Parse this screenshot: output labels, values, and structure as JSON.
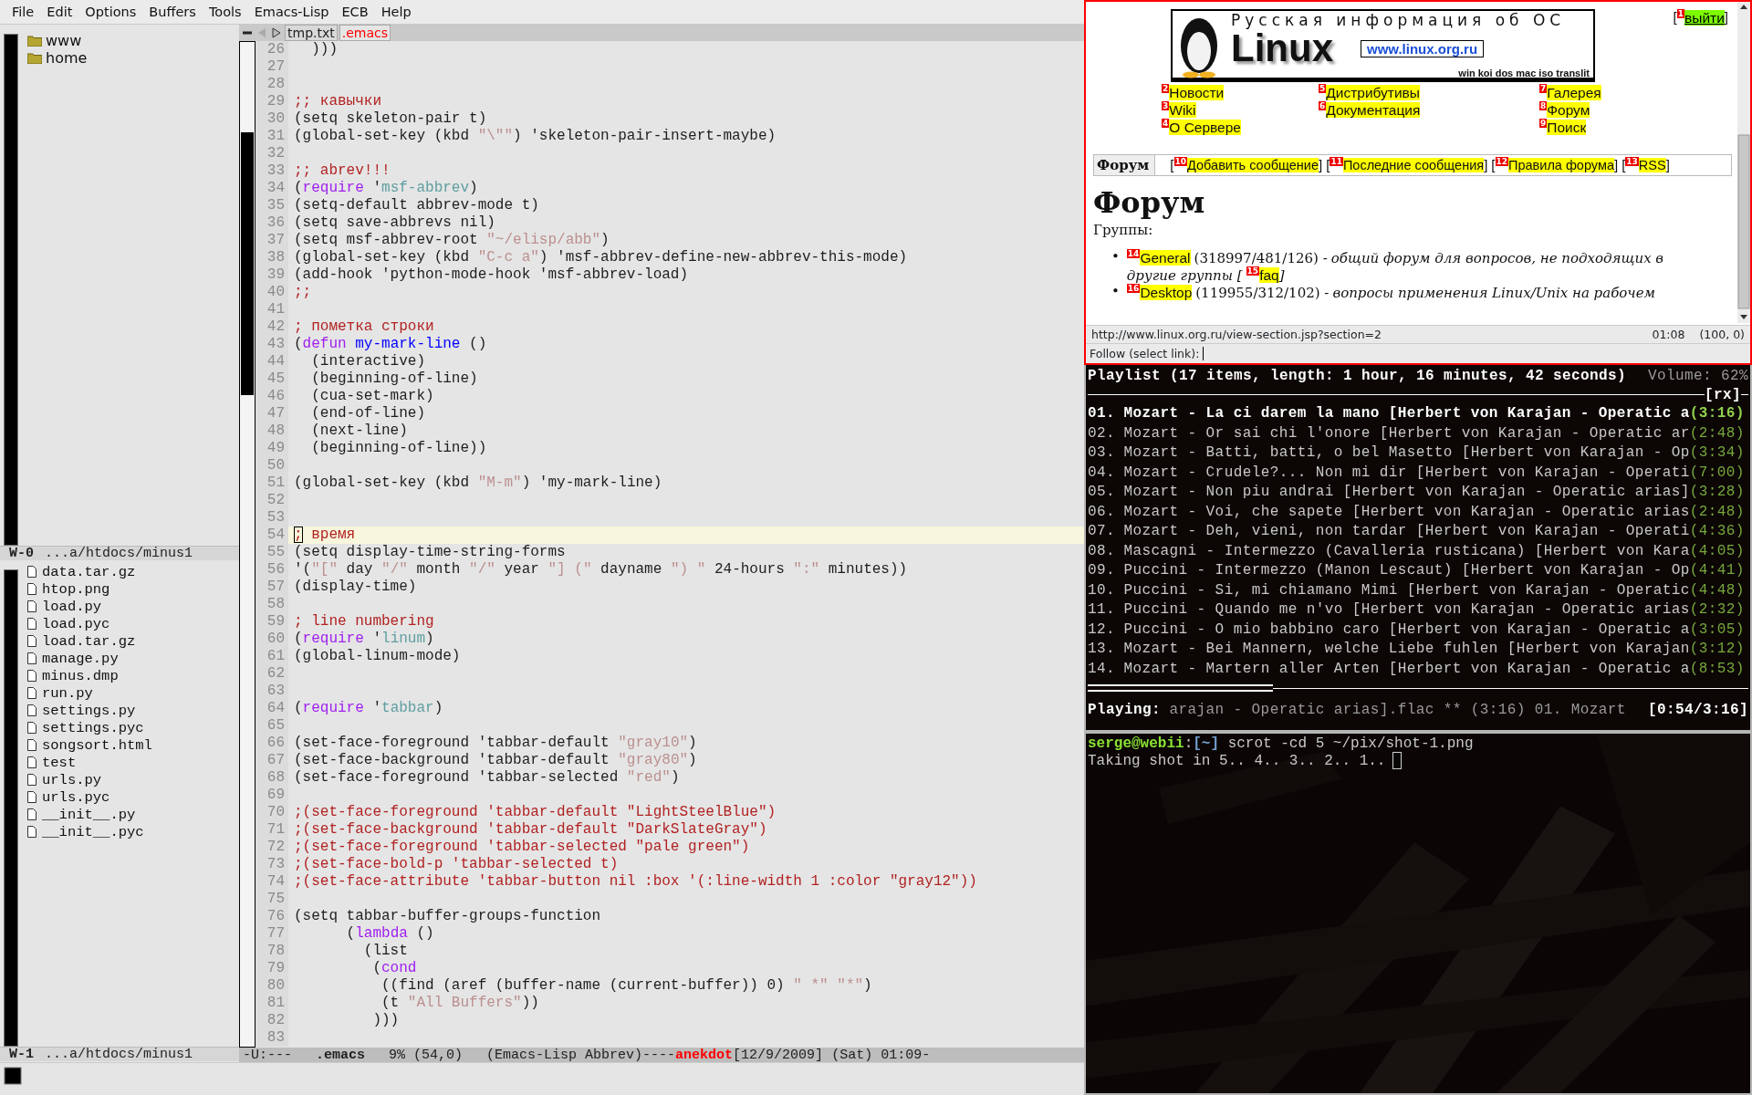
{
  "menu_bar": [
    "File",
    "Edit",
    "Options",
    "Buffers",
    "Tools",
    "Emacs-Lisp",
    "ECB",
    "Help"
  ],
  "ecb": {
    "directories": [
      "www",
      "home"
    ],
    "directories_mode_line": {
      "window": "W-0",
      "path": "...a/htdocs/minus1"
    },
    "files": [
      "data.tar.gz",
      "htop.png",
      "load.py",
      "load.pyc",
      "load.tar.gz",
      "manage.py",
      "minus.dmp",
      "run.py",
      "settings.py",
      "settings.pyc",
      "songsort.html",
      "test",
      "urls.py",
      "urls.pyc",
      "__init__.py",
      "__init__.pyc"
    ],
    "files_mode_line": {
      "window": "W-1",
      "path": "...a/htdocs/minus1"
    }
  },
  "editor": {
    "tabs": [
      {
        "label": "tmp.txt",
        "selected": false
      },
      {
        "label": ".emacs",
        "selected": true
      }
    ],
    "lines": [
      {
        "number": "26",
        "current": false,
        "segments": [
          {
            "text": "  )))",
            "kind": "plain"
          }
        ]
      },
      {
        "number": "27",
        "current": false
      },
      {
        "number": "28",
        "current": false
      },
      {
        "number": "29",
        "current": false,
        "segments": [
          {
            "text": ";; кавычки",
            "kind": "comment"
          }
        ]
      },
      {
        "number": "30",
        "current": false,
        "segments": [
          {
            "text": "(setq skeleton-pair t)",
            "kind": "plain"
          }
        ]
      },
      {
        "number": "31",
        "current": false,
        "segments": [
          {
            "text": "(global-set-key (kbd ",
            "kind": "plain"
          },
          {
            "text": "\"\\\"\"",
            "kind": "string"
          },
          {
            "text": ") 'skeleton-pair-insert-maybe)",
            "kind": "plain"
          }
        ]
      },
      {
        "number": "32",
        "current": false
      },
      {
        "number": "33",
        "current": false,
        "segments": [
          {
            "text": ";; abrev!!!",
            "kind": "comment"
          }
        ]
      },
      {
        "number": "34",
        "current": false,
        "segments": [
          {
            "text": "(",
            "kind": "plain"
          },
          {
            "text": "require",
            "kind": "keyword"
          },
          {
            "text": " '",
            "kind": "plain"
          },
          {
            "text": "msf-abbrev",
            "kind": "constant"
          },
          {
            "text": ")",
            "kind": "plain"
          }
        ]
      },
      {
        "number": "35",
        "current": false,
        "segments": [
          {
            "text": "(setq-default abbrev-mode t)",
            "kind": "plain"
          }
        ]
      },
      {
        "number": "36",
        "current": false,
        "segments": [
          {
            "text": "(setq save-abbrevs nil)",
            "kind": "plain"
          }
        ]
      },
      {
        "number": "37",
        "current": false,
        "segments": [
          {
            "text": "(setq msf-abbrev-root ",
            "kind": "plain"
          },
          {
            "text": "\"~/elisp/abb\"",
            "kind": "string"
          },
          {
            "text": ")",
            "kind": "plain"
          }
        ]
      },
      {
        "number": "38",
        "current": false,
        "segments": [
          {
            "text": "(global-set-key (kbd ",
            "kind": "plain"
          },
          {
            "text": "\"C-c a\"",
            "kind": "string"
          },
          {
            "text": ") 'msf-abbrev-define-new-abbrev-this-mode)",
            "kind": "plain"
          }
        ]
      },
      {
        "number": "39",
        "current": false,
        "segments": [
          {
            "text": "(add-hook 'python-mode-hook 'msf-abbrev-load)",
            "kind": "plain"
          }
        ]
      },
      {
        "number": "40",
        "current": false,
        "segments": [
          {
            "text": ";;",
            "kind": "comment"
          }
        ]
      },
      {
        "number": "41",
        "current": false
      },
      {
        "number": "42",
        "current": false,
        "segments": [
          {
            "text": "; пометка строки",
            "kind": "comment"
          }
        ]
      },
      {
        "number": "43",
        "current": false,
        "segments": [
          {
            "text": "(",
            "kind": "plain"
          },
          {
            "text": "defun",
            "kind": "keyword"
          },
          {
            "text": " my-mark-line",
            "kind": "function"
          },
          {
            "text": " ()",
            "kind": "plain"
          }
        ]
      },
      {
        "number": "44",
        "current": false,
        "segments": [
          {
            "text": "  (interactive)",
            "kind": "plain"
          }
        ]
      },
      {
        "number": "45",
        "current": false,
        "segments": [
          {
            "text": "  (beginning-of-line)",
            "kind": "plain"
          }
        ]
      },
      {
        "number": "46",
        "current": false,
        "segments": [
          {
            "text": "  (cua-set-mark)",
            "kind": "plain"
          }
        ]
      },
      {
        "number": "47",
        "current": false,
        "segments": [
          {
            "text": "  (end-of-line)",
            "kind": "plain"
          }
        ]
      },
      {
        "number": "48",
        "current": false,
        "segments": [
          {
            "text": "  (next-line)",
            "kind": "plain"
          }
        ]
      },
      {
        "number": "49",
        "current": false,
        "segments": [
          {
            "text": "  (beginning-of-line))",
            "kind": "plain"
          }
        ]
      },
      {
        "number": "50",
        "current": false
      },
      {
        "number": "51",
        "current": false,
        "segments": [
          {
            "text": "(global-set-key (kbd ",
            "kind": "plain"
          },
          {
            "text": "\"M-m\"",
            "kind": "string"
          },
          {
            "text": ") 'my-mark-line)",
            "kind": "plain"
          }
        ]
      },
      {
        "number": "52",
        "current": false
      },
      {
        "number": "53",
        "current": false
      },
      {
        "number": "54",
        "current": true,
        "segments": [
          {
            "text": ";",
            "kind": "cursor"
          },
          {
            "text": " время",
            "kind": "comment"
          }
        ]
      },
      {
        "number": "55",
        "current": false,
        "segments": [
          {
            "text": "(setq display-time-string-forms",
            "kind": "plain"
          }
        ]
      },
      {
        "number": "56",
        "current": false,
        "segments": [
          {
            "text": "'(",
            "kind": "plain"
          },
          {
            "text": "\"[\"",
            "kind": "string"
          },
          {
            "text": " day ",
            "kind": "plain"
          },
          {
            "text": "\"/\"",
            "kind": "string"
          },
          {
            "text": " month ",
            "kind": "plain"
          },
          {
            "text": "\"/\"",
            "kind": "string"
          },
          {
            "text": " year ",
            "kind": "plain"
          },
          {
            "text": "\"] (\"",
            "kind": "string"
          },
          {
            "text": " dayname ",
            "kind": "plain"
          },
          {
            "text": "\") \"",
            "kind": "string"
          },
          {
            "text": " 24-hours ",
            "kind": "plain"
          },
          {
            "text": "\":\"",
            "kind": "string"
          },
          {
            "text": " minutes))",
            "kind": "plain"
          }
        ]
      },
      {
        "number": "57",
        "current": false,
        "segments": [
          {
            "text": "(display-time)",
            "kind": "plain"
          }
        ]
      },
      {
        "number": "58",
        "current": false
      },
      {
        "number": "59",
        "current": false,
        "segments": [
          {
            "text": "; line numbering",
            "kind": "comment"
          }
        ]
      },
      {
        "number": "60",
        "current": false,
        "segments": [
          {
            "text": "(",
            "kind": "plain"
          },
          {
            "text": "require",
            "kind": "keyword"
          },
          {
            "text": " '",
            "kind": "plain"
          },
          {
            "text": "linum",
            "kind": "constant"
          },
          {
            "text": ")",
            "kind": "plain"
          }
        ]
      },
      {
        "number": "61",
        "current": false,
        "segments": [
          {
            "text": "(global-linum-mode)",
            "kind": "plain"
          }
        ]
      },
      {
        "number": "62",
        "current": false
      },
      {
        "number": "63",
        "current": false
      },
      {
        "number": "64",
        "current": false,
        "segments": [
          {
            "text": "(",
            "kind": "plain"
          },
          {
            "text": "require",
            "kind": "keyword"
          },
          {
            "text": " '",
            "kind": "plain"
          },
          {
            "text": "tabbar",
            "kind": "constant"
          },
          {
            "text": ")",
            "kind": "plain"
          }
        ]
      },
      {
        "number": "65",
        "current": false
      },
      {
        "number": "66",
        "current": false,
        "segments": [
          {
            "text": "(set-face-foreground 'tabbar-default ",
            "kind": "plain"
          },
          {
            "text": "\"gray10\"",
            "kind": "string"
          },
          {
            "text": ")",
            "kind": "plain"
          }
        ]
      },
      {
        "number": "67",
        "current": false,
        "segments": [
          {
            "text": "(set-face-background 'tabbar-default ",
            "kind": "plain"
          },
          {
            "text": "\"gray80\"",
            "kind": "string"
          },
          {
            "text": ")",
            "kind": "plain"
          }
        ]
      },
      {
        "number": "68",
        "current": false,
        "segments": [
          {
            "text": "(set-face-foreground 'tabbar-selected ",
            "kind": "plain"
          },
          {
            "text": "\"red\"",
            "kind": "string"
          },
          {
            "text": ")",
            "kind": "plain"
          }
        ]
      },
      {
        "number": "69",
        "current": false
      },
      {
        "number": "70",
        "current": false,
        "segments": [
          {
            "text": ";(set-face-foreground 'tabbar-default \"LightSteelBlue\")",
            "kind": "comment"
          }
        ]
      },
      {
        "number": "71",
        "current": false,
        "segments": [
          {
            "text": ";(set-face-background 'tabbar-default \"DarkSlateGray\")",
            "kind": "comment"
          }
        ]
      },
      {
        "number": "72",
        "current": false,
        "segments": [
          {
            "text": ";(set-face-foreground 'tabbar-selected \"pale green\")",
            "kind": "comment"
          }
        ]
      },
      {
        "number": "73",
        "current": false,
        "segments": [
          {
            "text": ";(set-face-bold-p 'tabbar-selected t)",
            "kind": "comment"
          }
        ]
      },
      {
        "number": "74",
        "current": false,
        "segments": [
          {
            "text": ";(set-face-attribute 'tabbar-button nil :box '(:line-width 1 :color \"gray12\"))",
            "kind": "comment"
          }
        ]
      },
      {
        "number": "75",
        "current": false
      },
      {
        "number": "76",
        "current": false,
        "segments": [
          {
            "text": "(setq tabbar-buffer-groups-function",
            "kind": "plain"
          }
        ]
      },
      {
        "number": "77",
        "current": false,
        "segments": [
          {
            "text": "      (",
            "kind": "plain"
          },
          {
            "text": "lambda",
            "kind": "keyword"
          },
          {
            "text": " ()",
            "kind": "plain"
          }
        ]
      },
      {
        "number": "78",
        "current": false,
        "segments": [
          {
            "text": "        (list",
            "kind": "plain"
          }
        ]
      },
      {
        "number": "79",
        "current": false,
        "segments": [
          {
            "text": "         (",
            "kind": "plain"
          },
          {
            "text": "cond",
            "kind": "keyword"
          }
        ]
      },
      {
        "number": "80",
        "current": false,
        "segments": [
          {
            "text": "          ((find (aref (buffer-name (current-buffer)) 0) ",
            "kind": "plain"
          },
          {
            "text": "\" *\"",
            "kind": "string"
          },
          {
            "text": " \"*\"",
            "kind": "string"
          },
          {
            "text": ")",
            "kind": "plain"
          }
        ]
      },
      {
        "number": "81",
        "current": false,
        "segments": [
          {
            "text": "          (t ",
            "kind": "plain"
          },
          {
            "text": "\"All Buffers\"",
            "kind": "string"
          },
          {
            "text": "))",
            "kind": "plain"
          }
        ]
      },
      {
        "number": "82",
        "current": false,
        "segments": [
          {
            "text": "         )))",
            "kind": "plain"
          }
        ]
      },
      {
        "number": "83",
        "current": false
      }
    ],
    "mode_line": [
      {
        "text": "-U:---",
        "kind": "plain"
      },
      {
        "text": ".emacs",
        "kind": "bold"
      },
      {
        "text": "9% (54,0)",
        "kind": "plain"
      },
      {
        "text": "(Emacs-Lisp Abbrev)----",
        "kind": "plain"
      },
      {
        "text": "anekdot",
        "kind": "alert"
      },
      {
        "text": "[12/9/2009] (Sat) 01:09-",
        "kind": "plain"
      }
    ]
  },
  "browser": {
    "logo": {
      "tagline": "Русская информация об ОС",
      "name": "Linux",
      "url": "www.linux.org.ru",
      "encodings": "win koi dos mac iso translit"
    },
    "logout": {
      "prefix": "[",
      "hint": "1",
      "text": "выйти",
      "suffix": "]",
      "focused": true
    },
    "nav_columns": [
      [
        {
          "hint": "2",
          "text": "Новости",
          "focused": false
        },
        {
          "hint": "3",
          "text": "Wiki",
          "focused": false
        },
        {
          "hint": "4",
          "text": "О Сервере",
          "focused": false
        }
      ],
      [
        {
          "hint": "5",
          "text": "Дистрибутивы",
          "focused": false
        },
        {
          "hint": "6",
          "text": "Документация",
          "focused": false
        }
      ],
      [
        {
          "hint": "7",
          "text": "Галерея",
          "focused": false
        },
        {
          "hint": "8",
          "text": "Форум",
          "focused": false
        },
        {
          "hint": "9",
          "text": "Поиск",
          "focused": false
        }
      ]
    ],
    "forum_bar": {
      "label": "Форум",
      "links": [
        {
          "prefix": "[",
          "hint": "10",
          "text": "Добавить сообщение",
          "suffix": "]",
          "focused": false
        },
        {
          "prefix": "[",
          "hint": "11",
          "text": "Последние сообщения",
          "suffix": "]",
          "focused": false
        },
        {
          "prefix": "[",
          "hint": "12",
          "text": "Правила форума",
          "suffix": "]",
          "focused": false
        },
        {
          "prefix": "[",
          "hint": "13",
          "text": "RSS",
          "suffix": "]",
          "focused": false
        }
      ]
    },
    "heading": "Форум",
    "groups_label": "Группы:",
    "groups": [
      {
        "bullet": "•",
        "link": {
          "hint": "14",
          "text": "General",
          "focused": false
        },
        "counts": "(318997/481/126) -",
        "description": "общий форум для вопросов, не подходящих в",
        "description_continued": "другие группы [",
        "faq": {
          "hint": "15",
          "text": "faq",
          "focused": false
        },
        "description_end": "]"
      },
      {
        "bullet": "•",
        "link": {
          "hint": "16",
          "text": "Desktop",
          "focused": false
        },
        "counts": "(119955/312/102) -",
        "description": "вопросы применения Linux/Unix на рабочем"
      }
    ],
    "status_url": "http://www.linux.org.ru/view-section.jsp?section=2",
    "status_time": "01:08",
    "status_position": "(100, 0)",
    "prompt": "Follow (select link):"
  },
  "playlist": {
    "header": "Playlist (17 items, length: 1 hour, 16 minutes, 42 seconds)",
    "volume": "Volume: 62%",
    "flag": "[rx]",
    "tracks": [
      {
        "number": "01.",
        "title": "Mozart - La ci darem la mano [Herbert von Karajan - Operatic a",
        "duration": "(3:16)",
        "selected": true
      },
      {
        "number": "02.",
        "title": "Mozart - Or sai chi l'onore [Herbert von Karajan - Operatic ar",
        "duration": "(2:48)",
        "selected": false
      },
      {
        "number": "03.",
        "title": "Mozart - Batti, batti, o bel Masetto [Herbert von Karajan - Op",
        "duration": "(3:34)",
        "selected": false
      },
      {
        "number": "04.",
        "title": "Mozart - Crudele?... Non mi dir [Herbert von Karajan - Operati",
        "duration": "(7:00)",
        "selected": false
      },
      {
        "number": "05.",
        "title": "Mozart - Non piu andrai [Herbert von Karajan - Operatic arias]",
        "duration": "(3:28)",
        "selected": false
      },
      {
        "number": "06.",
        "title": "Mozart - Voi, che sapete [Herbert von Karajan - Operatic arias",
        "duration": "(2:48)",
        "selected": false
      },
      {
        "number": "07.",
        "title": "Mozart - Deh, vieni, non tardar [Herbert von Karajan - Operati",
        "duration": "(4:36)",
        "selected": false
      },
      {
        "number": "08.",
        "title": "Mascagni - Intermezzo (Cavalleria rusticana) [Herbert von Kara",
        "duration": "(4:05)",
        "selected": false
      },
      {
        "number": "09.",
        "title": "Puccini - Intermezzo (Manon Lescaut) [Herbert von Karajan - Op",
        "duration": "(4:41)",
        "selected": false
      },
      {
        "number": "10.",
        "title": "Puccini - Si, mi chiamano Mimi [Herbert von Karajan - Operatic",
        "duration": "(4:48)",
        "selected": false
      },
      {
        "number": "11.",
        "title": "Puccini - Quando me n'vo [Herbert von Karajan - Operatic arias",
        "duration": "(2:32)",
        "selected": false
      },
      {
        "number": "12.",
        "title": "Puccini - O mio babbino caro [Herbert von Karajan - Operatic a",
        "duration": "(3:05)",
        "selected": false
      },
      {
        "number": "13.",
        "title": "Mozart - Bei Mannern, welche Liebe fuhlen [Herbert von Karajan",
        "duration": "(3:12)",
        "selected": false
      },
      {
        "number": "14.",
        "title": "Mozart - Martern aller Arten [Herbert von Karajan - Operatic a",
        "duration": "(8:53)",
        "selected": false
      }
    ],
    "progress": {
      "level": 0.28
    },
    "playing_label": "Playing:",
    "playing": "arajan - Operatic arias].flac ** (3:16) 01. Mozart",
    "time": "[0:54/3:16]"
  },
  "terminal": {
    "user_host": "serge@webii",
    "separator": ":",
    "cwd": "[~]",
    "command": "scrot -cd 5 ~/pix/shot-1.png",
    "output": "Taking shot in 5.. 4.. 3.. 2.. 1.."
  }
}
